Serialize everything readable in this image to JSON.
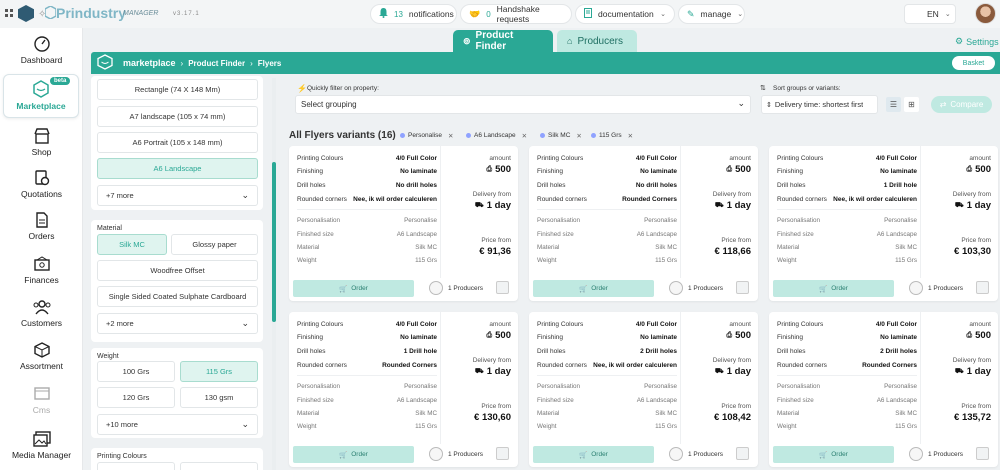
{
  "app": {
    "brand": "Prindustry",
    "brand_sub": "MANAGER",
    "version": "v3.17.1"
  },
  "topbar": {
    "notifications_count": "13",
    "notifications_label": "notifications",
    "handshake_count": "0",
    "handshake_label": "Handshake requests",
    "documentation_label": "documentation",
    "manage_label": "manage",
    "language": "EN"
  },
  "sidebar": [
    {
      "label": "Dashboard",
      "icon": "dashboard-icon"
    },
    {
      "label": "Marketplace",
      "icon": "marketplace-icon",
      "badge": "beta"
    },
    {
      "label": "Shop",
      "icon": "shop-icon"
    },
    {
      "label": "Quotations",
      "icon": "quotations-icon"
    },
    {
      "label": "Orders",
      "icon": "orders-icon"
    },
    {
      "label": "Finances",
      "icon": "finances-icon"
    },
    {
      "label": "Customers",
      "icon": "customers-icon"
    },
    {
      "label": "Assortment",
      "icon": "assortment-icon"
    },
    {
      "label": "Cms",
      "icon": "cms-icon"
    },
    {
      "label": "Media Manager",
      "icon": "media-manager-icon"
    }
  ],
  "tabs": {
    "product_finder": "Product Finder",
    "producers": "Producers",
    "settings": "Settings"
  },
  "breadcrumb": {
    "root": "marketplace",
    "level1": "Product Finder",
    "level2": "Flyers",
    "basket": "Basket"
  },
  "filters": {
    "sizes": [
      "Rectangle (74 X 148 Mm)",
      "A7 landscape (105 x 74 mm)",
      "A6 Portrait (105 x 148 mm)",
      "A6 Landscape"
    ],
    "sizes_more": "+7 more",
    "material_label": "Material",
    "materials": [
      "Silk MC",
      "Glossy paper",
      "Woodfree Offset",
      "Single Sided Coated Sulphate Cardboard"
    ],
    "materials_more": "+2 more",
    "weight_label": "Weight",
    "weights": [
      "100 Grs",
      "115 Grs",
      "120 Grs",
      "130 gsm"
    ],
    "weights_more": "+10 more",
    "printing_colours_label": "Printing Colours"
  },
  "controls": {
    "quick_filter_label": "Quickly filter on property:",
    "grouping_placeholder": "Select grouping",
    "sort_label": "Sort groups or variants:",
    "sort_value": "Delivery time: shortest first",
    "compare": "Compare"
  },
  "results": {
    "title": "All Flyers variants (16)",
    "chips": [
      "Personalise",
      "A6 Landscape",
      "Silk MC",
      "115 Grs"
    ]
  },
  "card_labels": {
    "printing_colours": "Printing Colours",
    "finishing": "Finishing",
    "drill_holes": "Drill holes",
    "rounded_corners": "Rounded corners",
    "personalisation": "Personalisation",
    "finished_size": "Finished size",
    "material": "Material",
    "weight": "Weight",
    "amount": "amount",
    "delivery_from": "Delivery from",
    "price_from": "Price from",
    "order": "Order",
    "producers": "1 Producers"
  },
  "cards": [
    {
      "colours": "4/0 Full Color",
      "finishing": "No laminate",
      "drill": "No drill holes",
      "corners": "Nee, ik wil order calculeren",
      "personalisation": "Personalise",
      "size": "A6 Landscape",
      "material": "Silk MC",
      "weight": "115 Grs",
      "amount": "500",
      "delivery": "1 day",
      "price": "€ 91,36"
    },
    {
      "colours": "4/0 Full Color",
      "finishing": "No laminate",
      "drill": "No drill holes",
      "corners": "Rounded Corners",
      "personalisation": "Personalise",
      "size": "A6 Landscape",
      "material": "Silk MC",
      "weight": "115 Grs",
      "amount": "500",
      "delivery": "1 day",
      "price": "€ 118,66"
    },
    {
      "colours": "4/0 Full Color",
      "finishing": "No laminate",
      "drill": "1 Drill hole",
      "corners": "Nee, ik wil order calculeren",
      "personalisation": "Personalise",
      "size": "A6 Landscape",
      "material": "Silk MC",
      "weight": "115 Grs",
      "amount": "500",
      "delivery": "1 day",
      "price": "€ 103,30"
    },
    {
      "colours": "4/0 Full Color",
      "finishing": "No laminate",
      "drill": "1 Drill hole",
      "corners": "Rounded Corners",
      "personalisation": "Personalise",
      "size": "A6 Landscape",
      "material": "Silk MC",
      "weight": "115 Grs",
      "amount": "500",
      "delivery": "1 day",
      "price": "€ 130,60"
    },
    {
      "colours": "4/0 Full Color",
      "finishing": "No laminate",
      "drill": "2 Drill holes",
      "corners": "Nee, ik wil order calculeren",
      "personalisation": "Personalise",
      "size": "A6 Landscape",
      "material": "Silk MC",
      "weight": "115 Grs",
      "amount": "500",
      "delivery": "1 day",
      "price": "€ 108,42"
    },
    {
      "colours": "4/0 Full Color",
      "finishing": "No laminate",
      "drill": "2 Drill holes",
      "corners": "Rounded Corners",
      "personalisation": "Personalise",
      "size": "A6 Landscape",
      "material": "Silk MC",
      "weight": "115 Grs",
      "amount": "500",
      "delivery": "1 day",
      "price": "€ 135,72"
    }
  ],
  "colors": {
    "accent": "#2aa895",
    "accent_light": "#bfe9e1"
  }
}
